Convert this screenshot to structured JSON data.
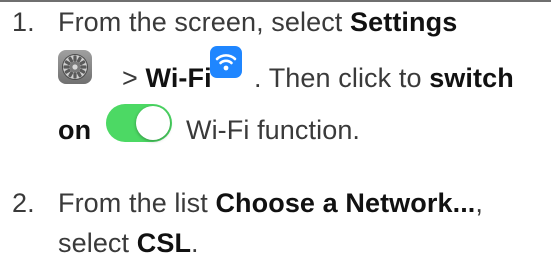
{
  "steps": [
    {
      "number": "1.",
      "line1_prefix": "From the screen, select ",
      "line1_bold": "Settings",
      "line2_sep": " > ",
      "line2_bold": "Wi-Fi",
      "line2_suffix": ". Then click to ",
      "line2_bold_end": "switch",
      "line3_bold": "on",
      "line3_suffix": "Wi-Fi function."
    },
    {
      "number": "2.",
      "line1_prefix": "From the list ",
      "line1_bold": "Choose a Network...",
      "line1_suffix": ",",
      "line2_prefix": "select ",
      "line2_bold": "CSL",
      "line2_suffix": "."
    }
  ],
  "icons": {
    "settings": "settings-gear-icon",
    "wifi": "wifi-icon",
    "toggle": "toggle-switch-on"
  },
  "colors": {
    "wifi_icon_bg": "#1f86ff",
    "toggle_on": "#4cd964",
    "settings_icon_bg": "#8a8a8a"
  }
}
